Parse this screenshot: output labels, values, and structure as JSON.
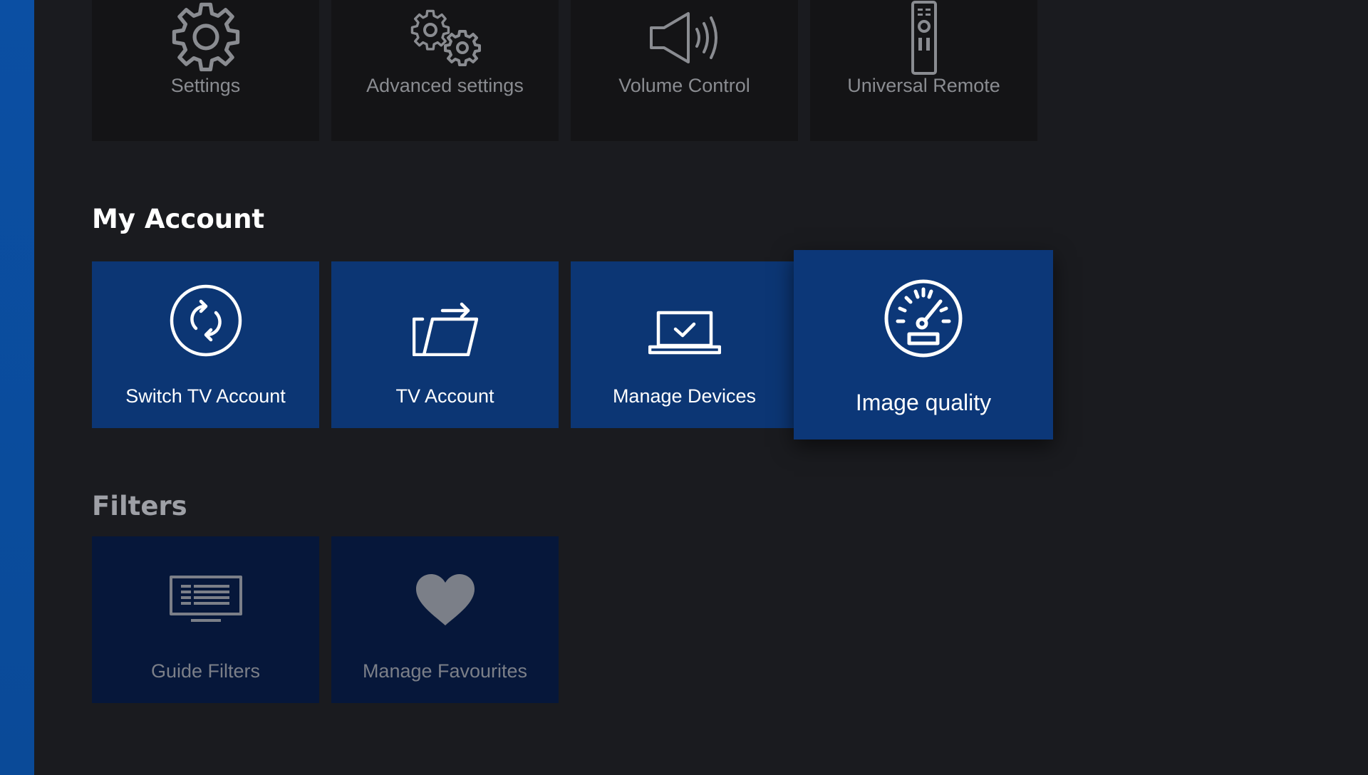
{
  "colors": {
    "background": "#1a1b1f",
    "side_strip": "#0b4fa3",
    "dark_tile": "#141416",
    "blue_tile": "#0c3674",
    "navy_tile": "#06173a"
  },
  "top_row": [
    {
      "label": "Settings",
      "icon": "gear-icon"
    },
    {
      "label": "Advanced settings",
      "icon": "gears-icon"
    },
    {
      "label": "Volume Control",
      "icon": "speaker-icon"
    },
    {
      "label": "Universal Remote",
      "icon": "remote-icon"
    }
  ],
  "my_account": {
    "title": "My Account",
    "items": [
      {
        "label": "Switch TV Account",
        "icon": "switch-account-icon"
      },
      {
        "label": "TV Account",
        "icon": "tv-account-icon"
      },
      {
        "label": "Manage Devices",
        "icon": "laptop-check-icon"
      },
      {
        "label": "Image quality",
        "icon": "speedometer-icon",
        "focused": true
      }
    ]
  },
  "filters": {
    "title": "Filters",
    "items": [
      {
        "label": "Guide Filters",
        "icon": "guide-icon"
      },
      {
        "label": "Manage Favourites",
        "icon": "heart-icon"
      }
    ]
  }
}
